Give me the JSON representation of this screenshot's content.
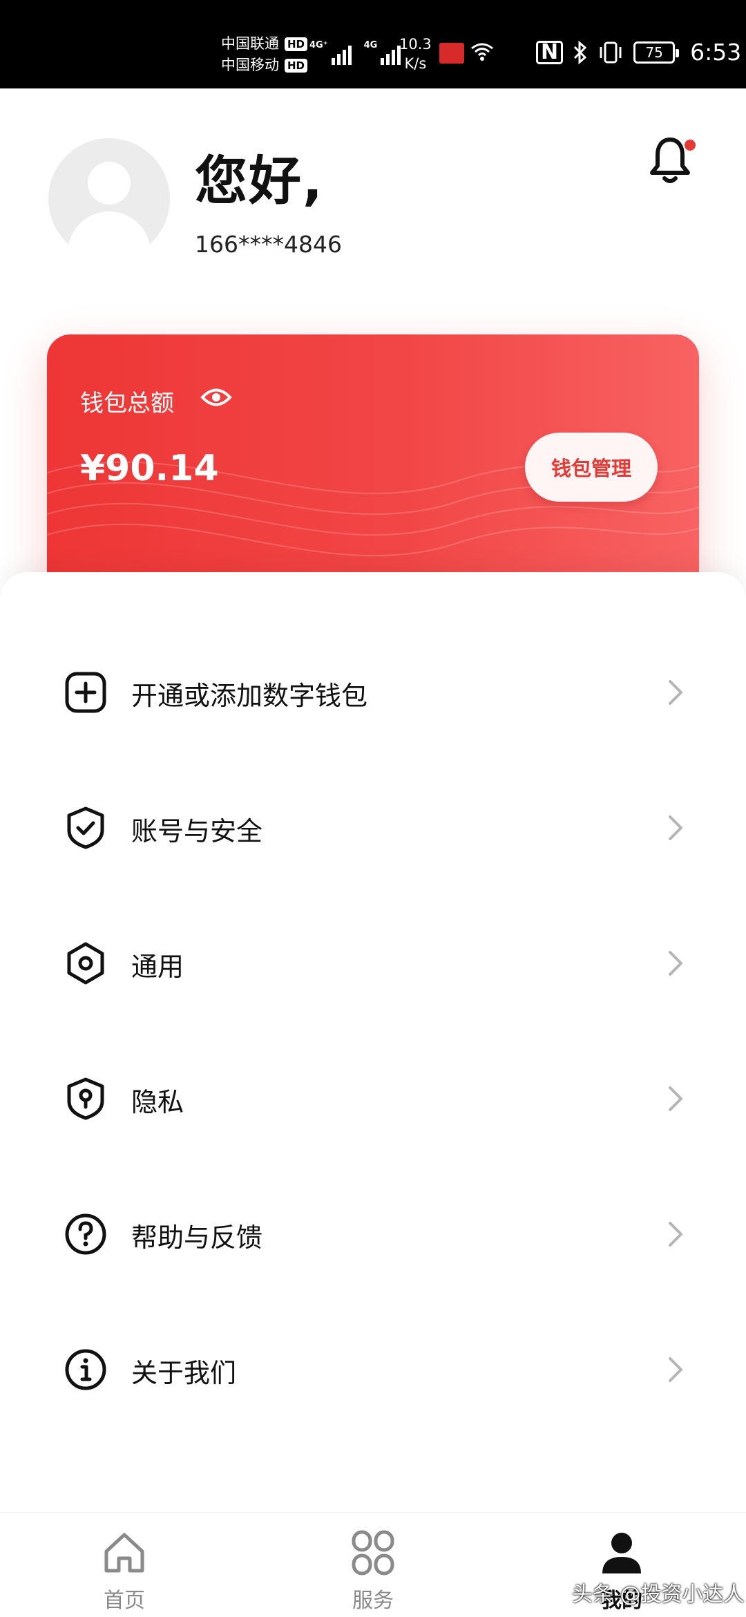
{
  "status_bar": {
    "carrier1": "中国联通",
    "carrier2": "中国移动",
    "hd": "HD",
    "network1": "4G⁺",
    "network2": "4G",
    "speed_value": "10.3",
    "speed_unit": "K/s",
    "nfc": "N",
    "battery": "75",
    "time": "6:53"
  },
  "profile": {
    "greeting": "您好,",
    "phone": "166****4846"
  },
  "wallet": {
    "label": "钱包总额",
    "amount": "¥90.14",
    "manage_label": "钱包管理"
  },
  "menu": {
    "items": [
      {
        "label": "开通或添加数字钱包",
        "icon": "plus-square-icon"
      },
      {
        "label": "账号与安全",
        "icon": "shield-check-icon"
      },
      {
        "label": "通用",
        "icon": "hexagon-gear-icon"
      },
      {
        "label": "隐私",
        "icon": "shield-keyhole-icon"
      },
      {
        "label": "帮助与反馈",
        "icon": "question-circle-icon"
      },
      {
        "label": "关于我们",
        "icon": "info-circle-icon"
      }
    ]
  },
  "bottom_nav": {
    "items": [
      {
        "label": "首页",
        "icon": "home-icon"
      },
      {
        "label": "服务",
        "icon": "services-grid-icon"
      },
      {
        "label": "我的",
        "icon": "person-icon"
      }
    ],
    "active": "我的"
  },
  "watermark": "头条 @投资小达人",
  "colors": {
    "accent": "#e53935",
    "card_start": "#ee3636",
    "card_end": "#f86262"
  }
}
